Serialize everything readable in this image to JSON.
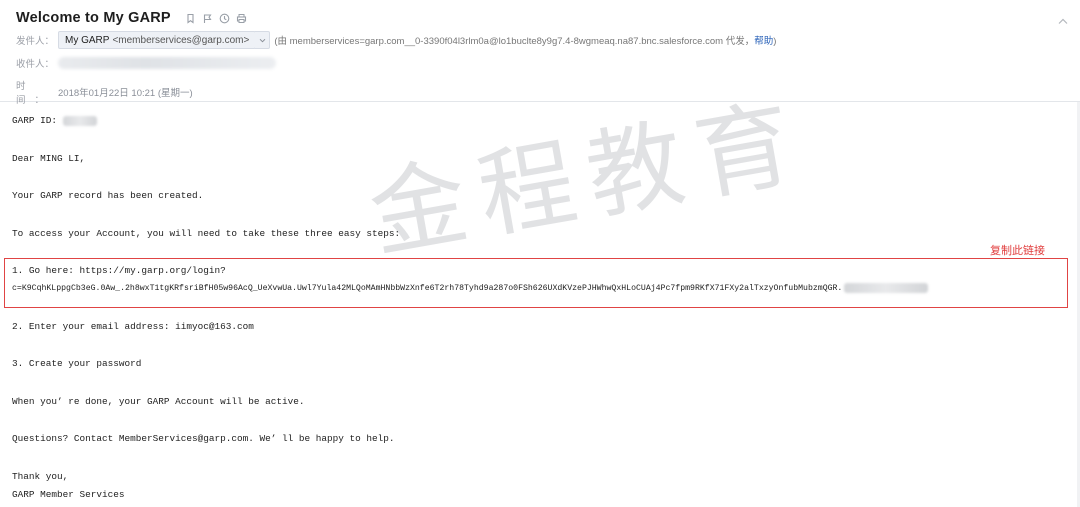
{
  "header": {
    "subject": "Welcome to My GARP",
    "icons": [
      "bookmark-icon",
      "flag-icon",
      "clock-icon",
      "print-icon"
    ],
    "sender_label": "发件人：",
    "sender_name": "My GARP",
    "sender_address": "<memberservices@garp.com>",
    "via_text": "(由 memberservices=garp.com__0-3390f04l3rlm0a@lo1buclte8y9g7.4-8wgmeaq.na87.bnc.salesforce.com 代发，",
    "help_link": "帮助",
    "via_close": ")",
    "recipient_label": "收件人：",
    "time_label": "时间：",
    "time_value": "2018年01月22日 10:21 (星期一)"
  },
  "body": {
    "garp_id": "GARP ID:",
    "greeting": "Dear MING LI,",
    "record": "Your GARP record has been created.",
    "access": "To access your Account, you will need to take these three easy steps:",
    "step1_line1": "1. Go here: https://my.garp.org/login?",
    "step1_line2": "c=K9CqhKLppgCb3eG.0Aw_.2h8wxT1tgKRfsriBfH05w96AcQ_UeXvwUa.Uwl7Yula42MLQoMAmHNbbWzXnfe6T2rh78Tyhd9a287o0FSh626UXdKVzePJHWhwQxHLoCUAj4Pc7fpm9RKfX71FXy2alTxzyOnfubMubzmQGR.",
    "step2": "2. Enter your email address: iimyoc@163.com",
    "step3": "3. Create your password",
    "done": "When you’ re done, your GARP Account will be active.",
    "questions": "Questions? Contact MemberServices@garp.com. We’ ll be happy to help.",
    "thanks": "Thank you,",
    "signature": "GARP Member Services"
  },
  "overlay": {
    "watermark": "金程教育",
    "copy_hint": "复制此链接",
    "highlight_color": "#e04444"
  }
}
